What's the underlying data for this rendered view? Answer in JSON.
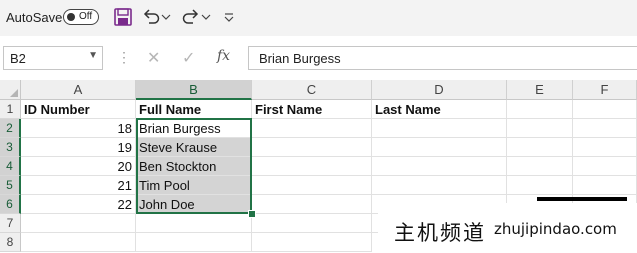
{
  "toolbar": {
    "autosave_label": "AutoSave",
    "autosave_state": "Off",
    "icons": [
      "save-icon",
      "undo-icon",
      "undo-dropdown-icon",
      "redo-icon",
      "redo-dropdown-icon",
      "customize-qat-icon"
    ]
  },
  "formula_bar": {
    "name_box": "B2",
    "cancel_symbol": "✕",
    "enter_symbol": "✓",
    "fx_label": "fx",
    "value": "Brian Burgess"
  },
  "sheet": {
    "columns": [
      "A",
      "B",
      "C",
      "D",
      "E",
      "F"
    ],
    "selected_column": "B",
    "rows": [
      "1",
      "2",
      "3",
      "4",
      "5",
      "6",
      "7",
      "8"
    ],
    "selected_rows": [
      "2",
      "3",
      "4",
      "5",
      "6"
    ],
    "headers": [
      "ID Number",
      "Full Name",
      "First Name",
      "Last Name"
    ],
    "data": [
      {
        "id": "18",
        "name": "Brian Burgess"
      },
      {
        "id": "19",
        "name": "Steve Krause"
      },
      {
        "id": "20",
        "name": "Ben Stockton"
      },
      {
        "id": "21",
        "name": "Tim Pool"
      },
      {
        "id": "22",
        "name": "John Doe"
      }
    ]
  },
  "watermark": {
    "cn": "主机频道",
    "url": "zhujipindao.com"
  },
  "colors": {
    "accent": "#217346",
    "selection_fill": "#d4d4d4",
    "header_bg": "#efefef"
  }
}
